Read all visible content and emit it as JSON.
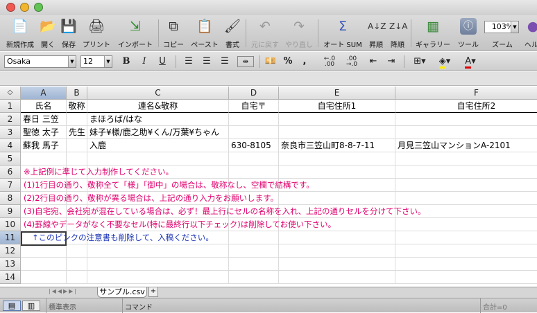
{
  "toolbar": {
    "new_label": "新規作成",
    "open_label": "開く",
    "save_label": "保存",
    "print_label": "プリント",
    "import_label": "インポート",
    "copy_label": "コピー",
    "paste_label": "ペースト",
    "format_label": "書式",
    "undo_label": "元に戻す",
    "redo_label": "やり直し",
    "autosum_label": "オート SUM",
    "sort_asc_label": "昇順",
    "sort_desc_label": "降順",
    "gallery_label": "ギャラリー",
    "tools_label": "ツール",
    "zoom_label": "ズーム",
    "zoom_value": "103%",
    "help_label": "ヘルプ"
  },
  "formatbar": {
    "font_name": "Osaka",
    "font_size": "12",
    "bold": "B",
    "italic": "I",
    "underline": "U",
    "percent": "%",
    "comma": ","
  },
  "grid": {
    "corner": "◇",
    "columns": [
      "A",
      "B",
      "C",
      "D",
      "E",
      "F"
    ],
    "rows": [
      "1",
      "2",
      "3",
      "4",
      "5",
      "6",
      "7",
      "8",
      "9",
      "10",
      "11",
      "12",
      "13",
      "14"
    ],
    "header_row": [
      "氏名",
      "敬称",
      "連名&敬称",
      "自宅〒",
      "自宅住所1",
      "自宅住所2"
    ],
    "data_rows": [
      [
        "春日 三笠",
        "",
        "まほろば/はな",
        "",
        "",
        ""
      ],
      [
        "聖徳 太子",
        "先生",
        "妹子¥様/鹿之助¥くん/万葉¥ちゃん",
        "",
        "",
        ""
      ],
      [
        "蘇我 馬子",
        "",
        "入鹿",
        "630-8105",
        "奈良市三笠山町8-8-7-11",
        "月見三笠山マンションA-2101"
      ]
    ],
    "notes": [
      "※上記例に準じて入力制作してください。",
      "(1)1行目の通り、敬称全て「様」「御中」の場合は、敬称なし、空欄で結構です。",
      "(2)2行目の通り、敬称が異る場合は、上記の通り入力をお願いします。",
      "(3)自宅宛、会社宛が混在している場合は、必ず！最上行にセルの名称を入れ、上記の通りセルを分けて下さい。",
      "(4)罫線やデータがなく不要なセル(特に最終行以下チェック)は削除してお使い下さい。",
      "↑このピンクの注意書も削除して、入稿ください。"
    ],
    "note_color": "#e0006e",
    "note_blue_color": "#1a33b5"
  },
  "sheets": {
    "active_tab": "サンプル.csv",
    "add_tab": "+"
  },
  "status": {
    "view_mode": "標準表示",
    "command": "コマンド",
    "sum": "合計=0"
  }
}
